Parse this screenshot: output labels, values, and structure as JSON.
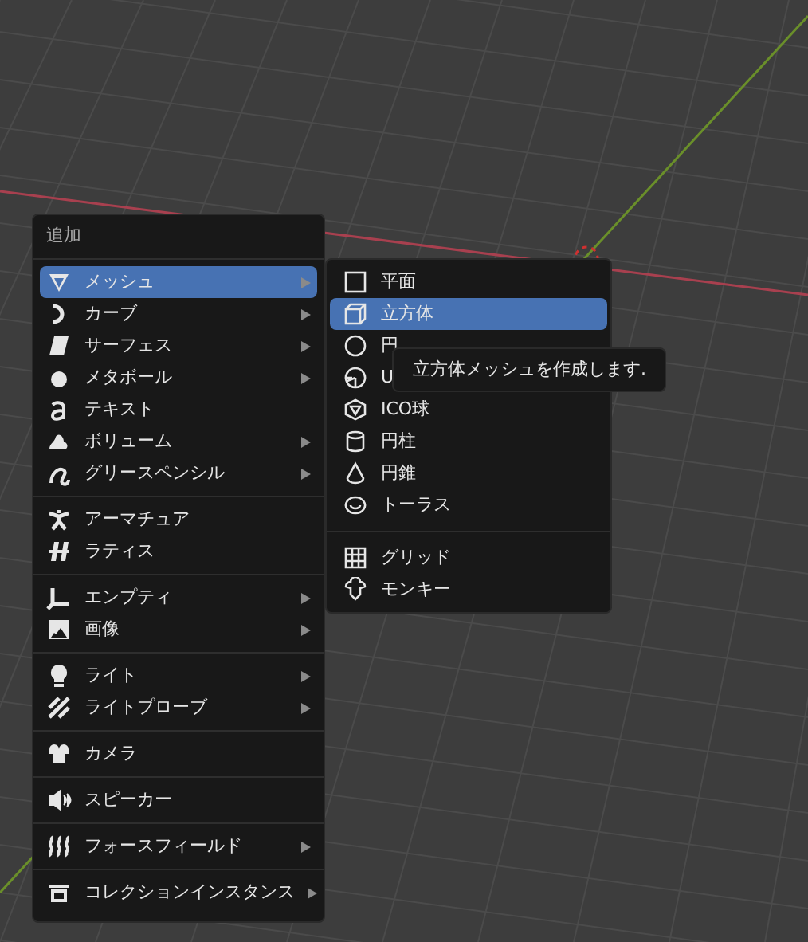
{
  "add_menu": {
    "title": "追加",
    "groups": [
      {
        "items": [
          {
            "label": "メッシュ",
            "has_submenu": true,
            "selected": true
          },
          {
            "label": "カーブ",
            "has_submenu": true,
            "selected": false
          },
          {
            "label": "サーフェス",
            "has_submenu": true,
            "selected": false
          },
          {
            "label": "メタボール",
            "has_submenu": true,
            "selected": false
          },
          {
            "label": "テキスト",
            "has_submenu": false,
            "selected": false
          },
          {
            "label": "ボリューム",
            "has_submenu": true,
            "selected": false
          },
          {
            "label": "グリースペンシル",
            "has_submenu": true,
            "selected": false
          }
        ]
      },
      {
        "items": [
          {
            "label": "アーマチュア",
            "has_submenu": false,
            "selected": false
          },
          {
            "label": "ラティス",
            "has_submenu": false,
            "selected": false
          }
        ]
      },
      {
        "items": [
          {
            "label": "エンプティ",
            "has_submenu": true,
            "selected": false
          },
          {
            "label": "画像",
            "has_submenu": true,
            "selected": false
          }
        ]
      },
      {
        "items": [
          {
            "label": "ライト",
            "has_submenu": true,
            "selected": false
          },
          {
            "label": "ライトプローブ",
            "has_submenu": true,
            "selected": false
          }
        ]
      },
      {
        "items": [
          {
            "label": "カメラ",
            "has_submenu": false,
            "selected": false
          }
        ]
      },
      {
        "items": [
          {
            "label": "スピーカー",
            "has_submenu": false,
            "selected": false
          }
        ]
      },
      {
        "items": [
          {
            "label": "フォースフィールド",
            "has_submenu": true,
            "selected": false
          }
        ]
      },
      {
        "items": [
          {
            "label": "コレクションインスタンス",
            "has_submenu": true,
            "selected": false
          }
        ]
      }
    ]
  },
  "mesh_submenu": {
    "groups": [
      {
        "items": [
          {
            "label": "平面",
            "selected": false
          },
          {
            "label": "立方体",
            "selected": true
          },
          {
            "label": "円",
            "selected": false
          },
          {
            "label": "U",
            "selected": false
          },
          {
            "label": "ICO球",
            "selected": false
          },
          {
            "label": "円柱",
            "selected": false
          },
          {
            "label": "円錐",
            "selected": false
          },
          {
            "label": "トーラス",
            "selected": false
          }
        ]
      },
      {
        "items": [
          {
            "label": "グリッド",
            "selected": false
          },
          {
            "label": "モンキー",
            "selected": false
          }
        ]
      }
    ]
  },
  "tooltip": {
    "text": "立方体メッシュを作成します."
  }
}
